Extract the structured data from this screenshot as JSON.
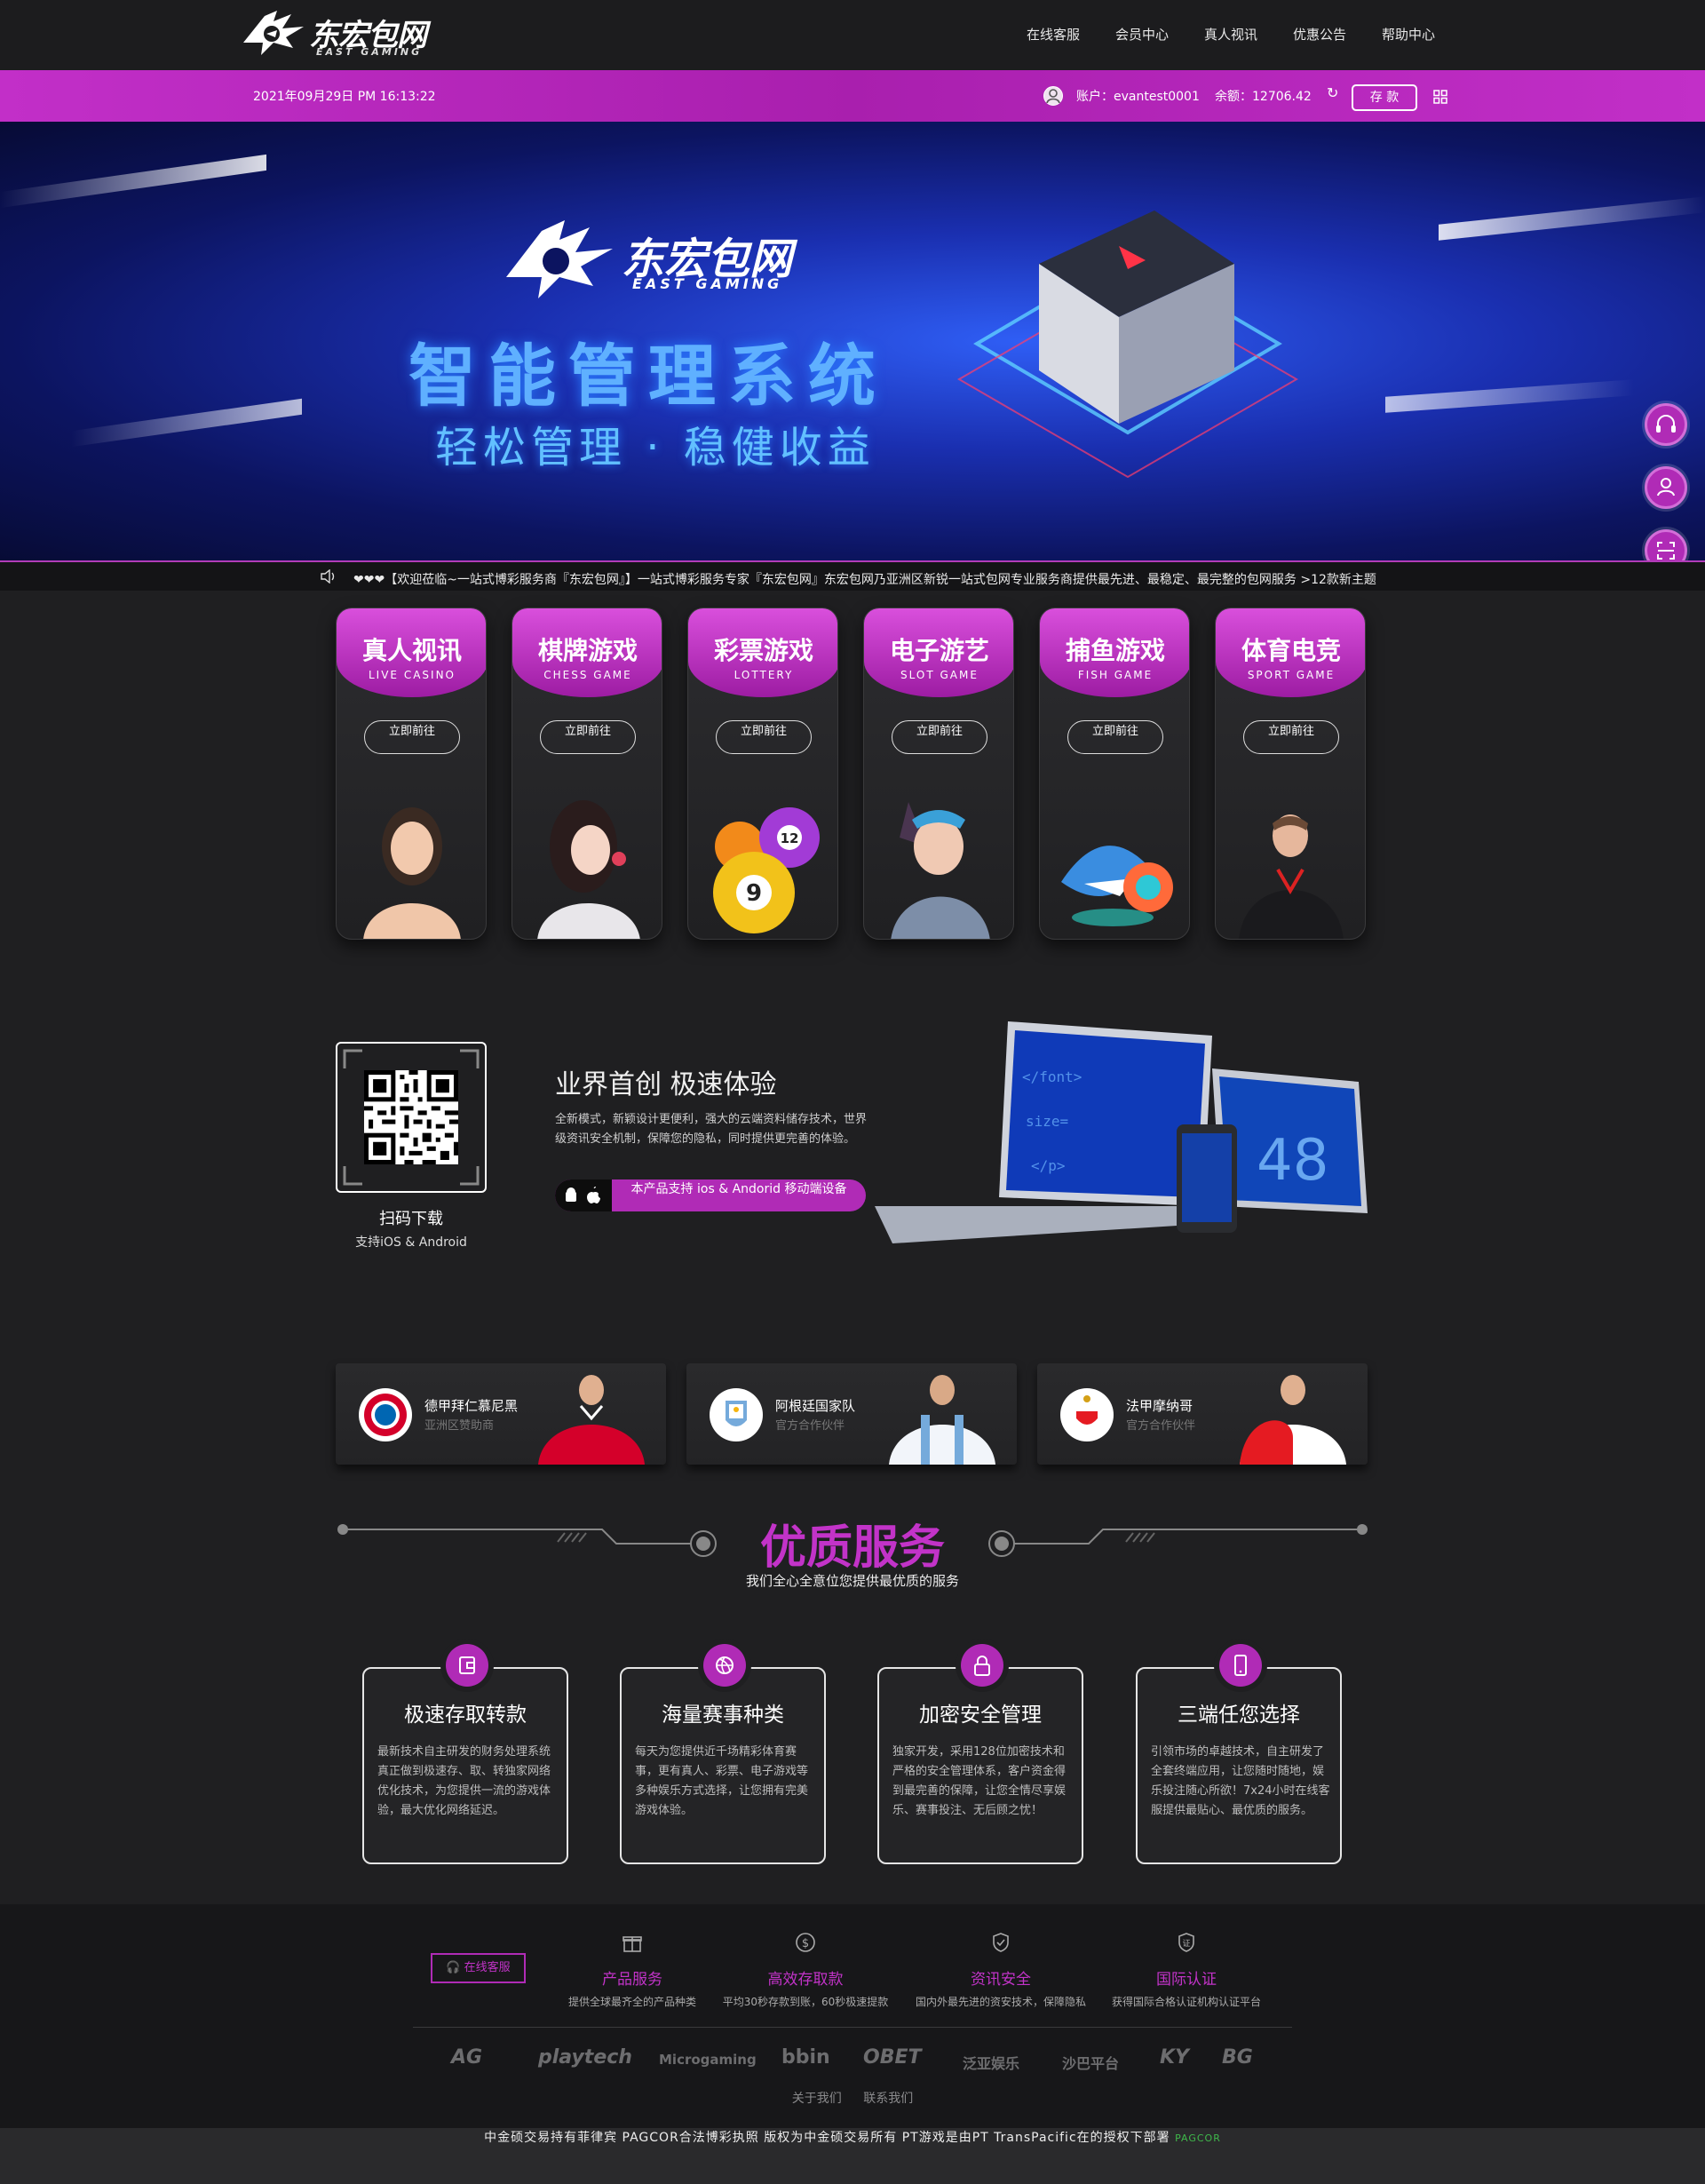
{
  "brand": {
    "name_cn": "东宏包网",
    "name_en": "EAST GAMING"
  },
  "nav": {
    "items": [
      "在线客服",
      "会员中心",
      "真人视讯",
      "优惠公告",
      "帮助中心"
    ]
  },
  "account_bar": {
    "datetime": "2021年09月29日 PM 16:13:22",
    "account_label": "账户：evantest0001",
    "balance_label": "余额：12706.42",
    "deposit_label": "存 款"
  },
  "banner": {
    "title": "智能管理系统",
    "subtitle": "轻松管理 · 稳健收益"
  },
  "marquee": {
    "text": "❤❤❤【欢迎莅临~一站式博彩服务商『东宏包网』】一站式博彩服务专家『东宏包网』东宏包网乃亚洲区新锐一站式包网专业服务商提供最先进、最稳定、最完整的包网服务 >12款新主题"
  },
  "games": [
    {
      "title": "真人视讯",
      "en": "LIVE CASINO",
      "cta": "立即前往"
    },
    {
      "title": "棋牌游戏",
      "en": "CHESS GAME",
      "cta": "立即前往"
    },
    {
      "title": "彩票游戏",
      "en": "LOTTERY",
      "cta": "立即前往"
    },
    {
      "title": "电子游艺",
      "en": "SLOT GAME",
      "cta": "立即前往"
    },
    {
      "title": "捕鱼游戏",
      "en": "FISH GAME",
      "cta": "立即前往"
    },
    {
      "title": "体育电竞",
      "en": "SPORT GAME",
      "cta": "立即前往"
    }
  ],
  "app": {
    "qr_title": "扫码下载",
    "qr_sub": "支持iOS & Android",
    "heading": "业界首创 极速体验",
    "desc": "全新模式，新颖设计更便利，强大的云端资料储存技术，世界级资讯安全机制，保障您的隐私，同时提供更完善的体验。",
    "os_label": "本产品支持 ios & Andorid 移动端设备"
  },
  "sponsors": [
    {
      "name": "德甲拜仁慕尼黑",
      "sub": "亚洲区赞助商"
    },
    {
      "name": "阿根廷国家队",
      "sub": "官方合作伙伴"
    },
    {
      "name": "法甲摩纳哥",
      "sub": "官方合作伙伴"
    }
  ],
  "services": {
    "title": "优质服务",
    "subtitle": "我们全心全意位您提供最优质的服务",
    "items": [
      {
        "title": "极速存取转款",
        "desc": "最新技术自主研发的财务处理系统真正做到极速存、取、转独家网络优化技术，为您提供一流的游戏体验，最大优化网络延迟。"
      },
      {
        "title": "海量赛事种类",
        "desc": "每天为您提供近千场精彩体育赛事，更有真人、彩票、电子游戏等多种娱乐方式选择，让您拥有完美游戏体验。"
      },
      {
        "title": "加密安全管理",
        "desc": "独家开发，采用128位加密技术和严格的安全管理体系，客户资金得到最完善的保障，让您全情尽享娱乐、赛事投注、无后顾之忧！"
      },
      {
        "title": "三端任您选择",
        "desc": "引领市场的卓越技术，自主研发了全套终端应用，让您随时随地，娱乐投注随心所欲！7x24小时在线客服提供最贴心、最优质的服务。"
      }
    ]
  },
  "footer": {
    "cs_label": "在线客服",
    "features": [
      {
        "title": "产品服务",
        "desc": "提供全球最齐全的产品种类"
      },
      {
        "title": "高效存取款",
        "desc": "平均30秒存款到账，60秒极速提款"
      },
      {
        "title": "资讯安全",
        "desc": "国内外最先进的资安技术，保障隐私"
      },
      {
        "title": "国际认证",
        "desc": "获得国际合格认证机构认证平台"
      }
    ],
    "platforms": [
      "AG",
      "playtech",
      "Microgaming",
      "bbin",
      "OBET",
      "泛亚娱乐",
      "沙巴平台",
      "KY",
      "BG"
    ],
    "links": [
      "关于我们",
      "联系我们"
    ],
    "legal": "中金硕交易持有菲律宾 PAGCOR合法博彩执照 版权为中金硕交易所有 PT游戏是由PT TransPacific在的授权下部署",
    "pagcor": "PAGCOR"
  },
  "colors": {
    "accent": "#b02bb6",
    "accent_light": "#c233c8",
    "bg": "#1f1f21"
  }
}
